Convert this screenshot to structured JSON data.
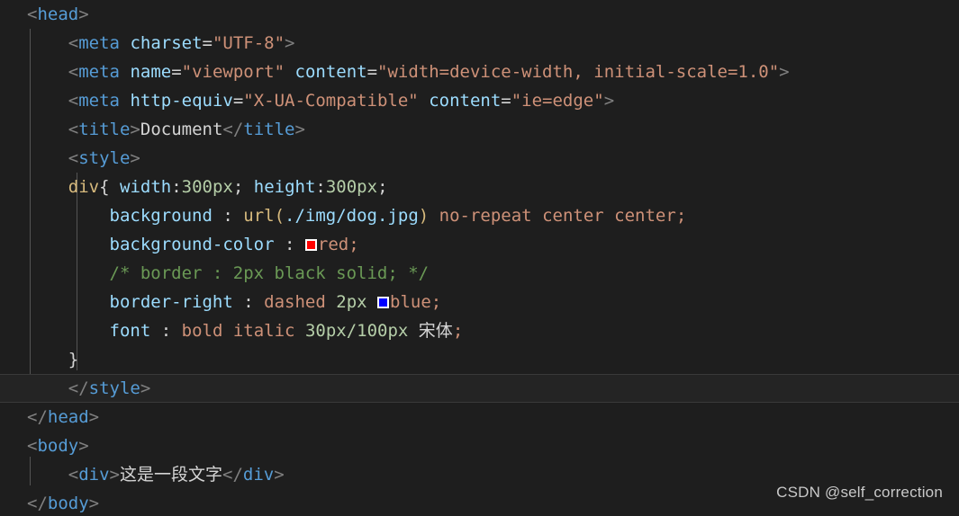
{
  "editor": {
    "theme": "dark-plus",
    "background": "#1e1e1e",
    "current_line_background": "#242424",
    "language": "html",
    "watermark": "CSDN @self_correction"
  },
  "colors": {
    "punctuation": "#808080",
    "tag": "#569cd6",
    "attribute": "#9cdcfe",
    "string": "#ce9178",
    "selector": "#d7ba7d",
    "property": "#9cdcfe",
    "number": "#b5cea8",
    "keyword": "#ce9178",
    "function": "#d7ba7d",
    "comment": "#6a9955",
    "plain": "#d4d4d4",
    "swatch_red": "#ff0000",
    "swatch_blue": "#0000ff",
    "swatch_border": "#ffffff"
  },
  "code": {
    "l1": {
      "lt": "<",
      "tag": "head",
      "gt": ">"
    },
    "l2": {
      "lt": "<",
      "tag": "meta",
      "attr": "charset",
      "eq": "=",
      "value": "\"UTF-8\"",
      "gt": ">"
    },
    "l3": {
      "lt": "<",
      "tag": "meta",
      "attr1": "name",
      "eq1": "=",
      "value1": "\"viewport\"",
      "attr2": "content",
      "eq2": "=",
      "value2": "\"width=device-width, initial-scale=1.0\"",
      "gt": ">"
    },
    "l4": {
      "lt": "<",
      "tag": "meta",
      "attr1": "http-equiv",
      "eq1": "=",
      "value1": "\"X-UA-Compatible\"",
      "attr2": "content",
      "eq2": "=",
      "value2": "\"ie=edge\"",
      "gt": ">"
    },
    "l5": {
      "lt": "<",
      "tag": "title",
      "gt": ">",
      "text": "Document",
      "close_lt": "</",
      "close_tag": "title",
      "close_gt": ">"
    },
    "l6": {
      "lt": "<",
      "tag": "style",
      "gt": ">"
    },
    "l7": {
      "selector": "div",
      "brace": "{",
      "prop1": "width",
      "colon1": ":",
      "value1": "300px",
      "semi1": ";",
      "prop2": "height",
      "colon2": ":",
      "value2": "300px",
      "semi2": ";"
    },
    "l8": {
      "prop": "background",
      "colon": ":",
      "fn": "url",
      "paren_open": "(",
      "path": "./img/dog.jpg",
      "paren_close": ")",
      "kw1": "no-repeat",
      "kw2": "center",
      "kw3": "center",
      "semi": ";"
    },
    "l9": {
      "prop": "background-color",
      "colon": ":",
      "swatch": "#ff0000",
      "value": "red",
      "semi": ";"
    },
    "l10": {
      "comment": "/* border : 2px black solid; */"
    },
    "l11": {
      "prop": "border-right",
      "colon": ":",
      "kw": "dashed",
      "num": "2px",
      "swatch": "#0000ff",
      "value": "blue",
      "semi": ";"
    },
    "l12": {
      "prop": "font",
      "colon": ":",
      "kw1": "bold",
      "kw2": "italic",
      "num": "30px/100px",
      "family": "宋体",
      "semi": ";"
    },
    "l13": {
      "brace": "}"
    },
    "l14": {
      "lt": "</",
      "tag": "style",
      "gt": ">"
    },
    "l15": {
      "lt": "</",
      "tag": "head",
      "gt": ">"
    },
    "l16": {
      "lt": "<",
      "tag": "body",
      "gt": ">"
    },
    "l17": {
      "lt": "<",
      "tag": "div",
      "gt": ">",
      "text": "这是一段文字",
      "close_lt": "</",
      "close_tag": "div",
      "close_gt": ">"
    },
    "l18": {
      "lt": "</",
      "tag": "body",
      "gt": ">"
    }
  }
}
